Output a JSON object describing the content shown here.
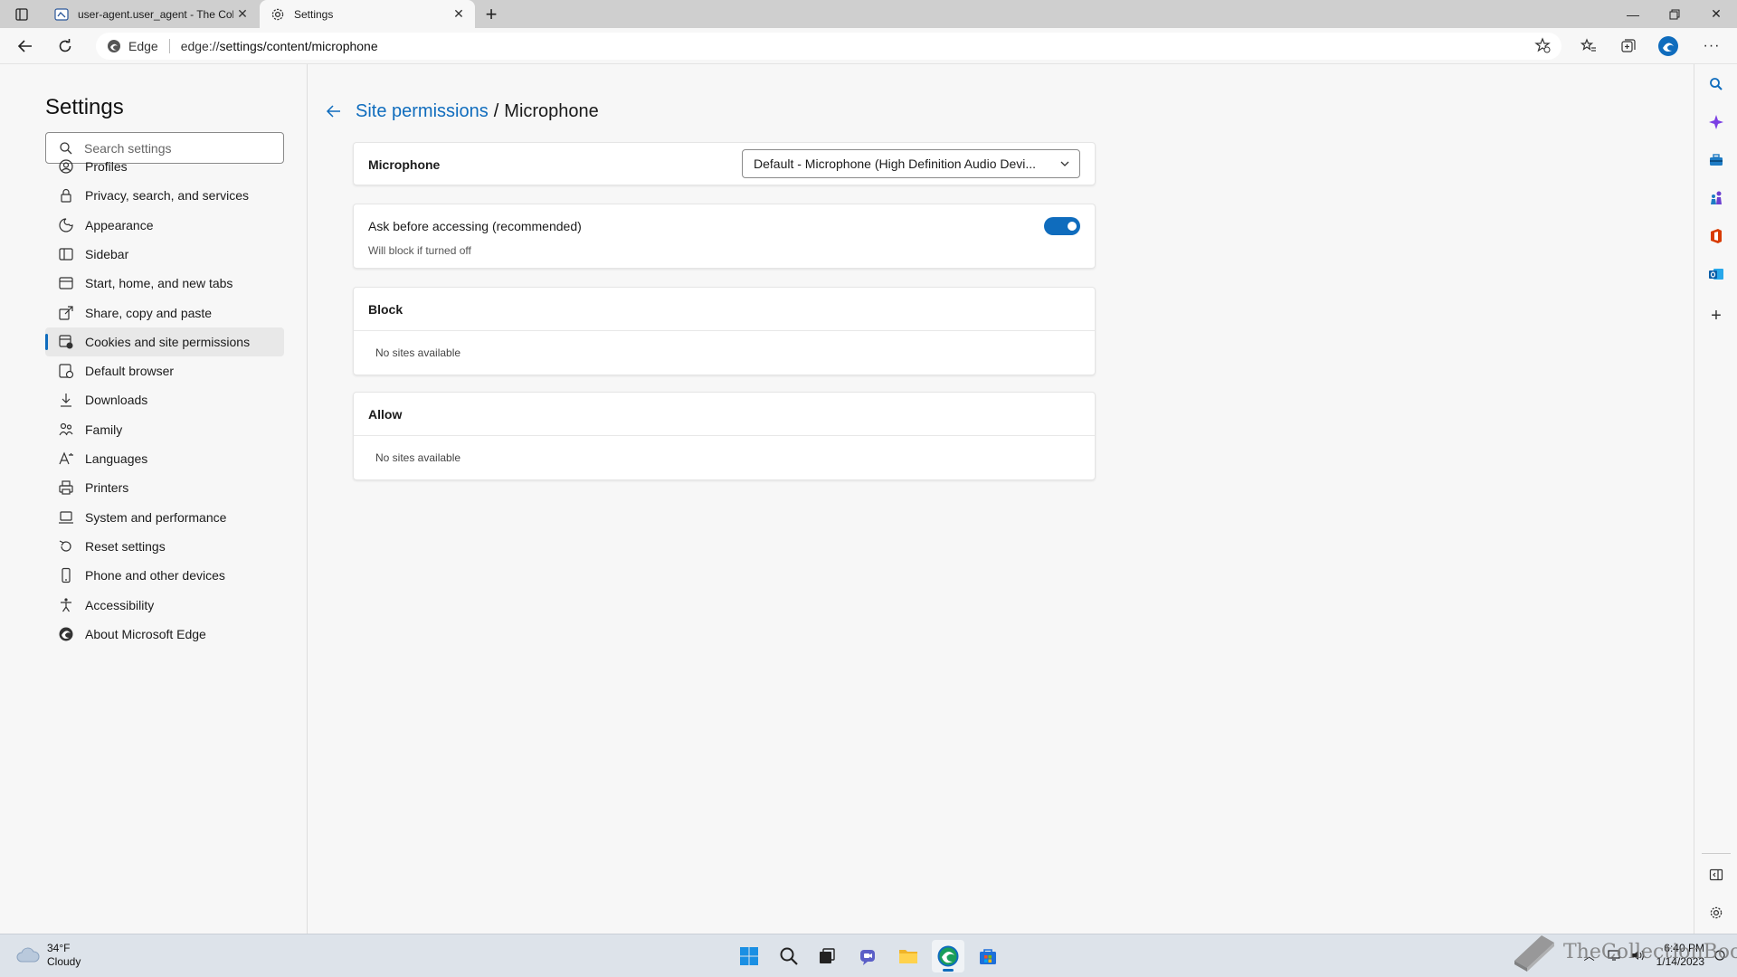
{
  "browser": {
    "tabs": [
      {
        "title": "user-agent.user_agent - The Coll",
        "active": false
      },
      {
        "title": "Settings",
        "active": true
      }
    ],
    "address": {
      "site_label": "Edge",
      "url_prefix": "edge://",
      "url_path": "settings/content/microphone"
    }
  },
  "settings": {
    "title": "Settings",
    "search_placeholder": "Search settings",
    "nav": [
      {
        "label": "Profiles",
        "icon": "profile-icon"
      },
      {
        "label": "Privacy, search, and services",
        "icon": "lock-icon"
      },
      {
        "label": "Appearance",
        "icon": "appearance-icon"
      },
      {
        "label": "Sidebar",
        "icon": "sidebar-icon"
      },
      {
        "label": "Start, home, and new tabs",
        "icon": "home-tabs-icon"
      },
      {
        "label": "Share, copy and paste",
        "icon": "share-icon"
      },
      {
        "label": "Cookies and site permissions",
        "icon": "cookies-icon",
        "active": true
      },
      {
        "label": "Default browser",
        "icon": "default-browser-icon"
      },
      {
        "label": "Downloads",
        "icon": "download-icon"
      },
      {
        "label": "Family",
        "icon": "family-icon"
      },
      {
        "label": "Languages",
        "icon": "languages-icon"
      },
      {
        "label": "Printers",
        "icon": "printer-icon"
      },
      {
        "label": "System and performance",
        "icon": "laptop-icon"
      },
      {
        "label": "Reset settings",
        "icon": "reset-icon"
      },
      {
        "label": "Phone and other devices",
        "icon": "phone-icon"
      },
      {
        "label": "Accessibility",
        "icon": "accessibility-icon"
      },
      {
        "label": "About Microsoft Edge",
        "icon": "edge-icon"
      }
    ]
  },
  "page": {
    "breadcrumb_parent": "Site permissions",
    "breadcrumb_separator": "/",
    "breadcrumb_current": "Microphone",
    "microphone": {
      "label": "Microphone",
      "selected": "Default - Microphone (High Definition Audio Devi..."
    },
    "ask": {
      "label": "Ask before accessing (recommended)",
      "sublabel": "Will block if turned off",
      "enabled": true
    },
    "block": {
      "title": "Block",
      "empty": "No sites available"
    },
    "allow": {
      "title": "Allow",
      "empty": "No sites available"
    }
  },
  "taskbar": {
    "weather_temp": "34°F",
    "weather_desc": "Cloudy",
    "time": "6:40 PM",
    "date": "1/14/2023",
    "watermark": "TheCollectionBook"
  },
  "colors": {
    "accent": "#0f6cbd",
    "background": "#f7f7f7"
  }
}
